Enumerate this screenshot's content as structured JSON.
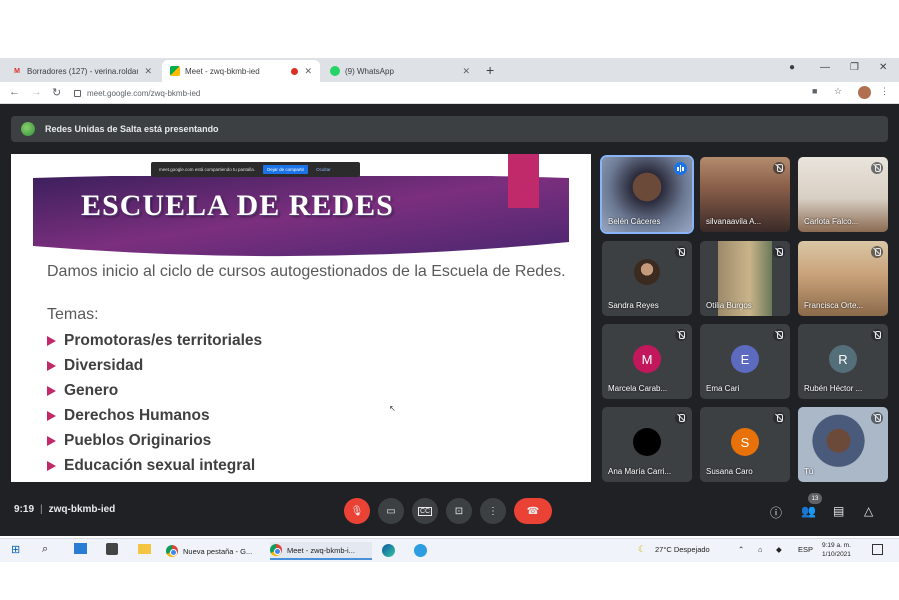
{
  "browser": {
    "tabs": [
      {
        "title": "Borradores (127) - verina.roldan",
        "favicon": "gmail-icon",
        "active": false
      },
      {
        "title": "Meet - zwq-bkmb-ied",
        "favicon": "meet-icon",
        "active": true,
        "recording": true
      },
      {
        "title": "(9) WhatsApp",
        "favicon": "whatsapp-icon",
        "active": false
      }
    ],
    "url": "meet.google.com/zwq-bkmb-ied"
  },
  "meet": {
    "presenting_text": "Redes Unidas de Salta está presentando",
    "share_bar": {
      "message": "meet.google.com está compartiendo tu pantalla.",
      "stop_label": "Dejar de compartir",
      "hide_label": "Ocultar"
    },
    "slide": {
      "title": "ESCUELA DE REDES",
      "intro": "Damos inicio al ciclo de cursos autogestionados de la Escuela de Redes.",
      "temas_label": "Temas:",
      "topics": [
        "Promotoras/es territoriales",
        "Diversidad",
        "Genero",
        "Derechos Humanos",
        "Pueblos Originarios",
        "Educación sexual integral"
      ]
    },
    "participants": [
      {
        "name": "Belén Cáceres",
        "state": "speaking",
        "type": "video"
      },
      {
        "name": "silvanaavila A...",
        "state": "muted",
        "type": "video"
      },
      {
        "name": "Carlota Falco...",
        "state": "muted",
        "type": "video"
      },
      {
        "name": "Sandra Reyes",
        "state": "muted",
        "type": "photo"
      },
      {
        "name": "Otilia Burgos",
        "state": "muted",
        "type": "video"
      },
      {
        "name": "Francisca Orte...",
        "state": "muted",
        "type": "video"
      },
      {
        "name": "Marcela Carab...",
        "state": "muted",
        "type": "initial",
        "initial": "M",
        "color": "#c2185b"
      },
      {
        "name": "Ema Cari",
        "state": "muted",
        "type": "initial",
        "initial": "E",
        "color": "#5c6bc0"
      },
      {
        "name": "Rubén Héctor ...",
        "state": "muted",
        "type": "initial",
        "initial": "R",
        "color": "#546e7a"
      },
      {
        "name": "Ana María Carri...",
        "state": "muted",
        "type": "photo-dark"
      },
      {
        "name": "Susana Caro",
        "state": "muted",
        "type": "initial",
        "initial": "S",
        "color": "#e8710a"
      },
      {
        "name": "Tú",
        "state": "muted",
        "type": "video"
      }
    ],
    "time": "9:19",
    "meeting_code": "zwq-bkmb-ied",
    "people_count": "13"
  },
  "taskbar": {
    "apps": [
      {
        "label": "Nueva pestaña - G..."
      },
      {
        "label": "Meet - zwq-bkmb-i..."
      }
    ],
    "weather": "27°C  Despejado",
    "language": "ESP",
    "clock_time": "9:19 a. m.",
    "clock_date": "1/10/2021"
  }
}
